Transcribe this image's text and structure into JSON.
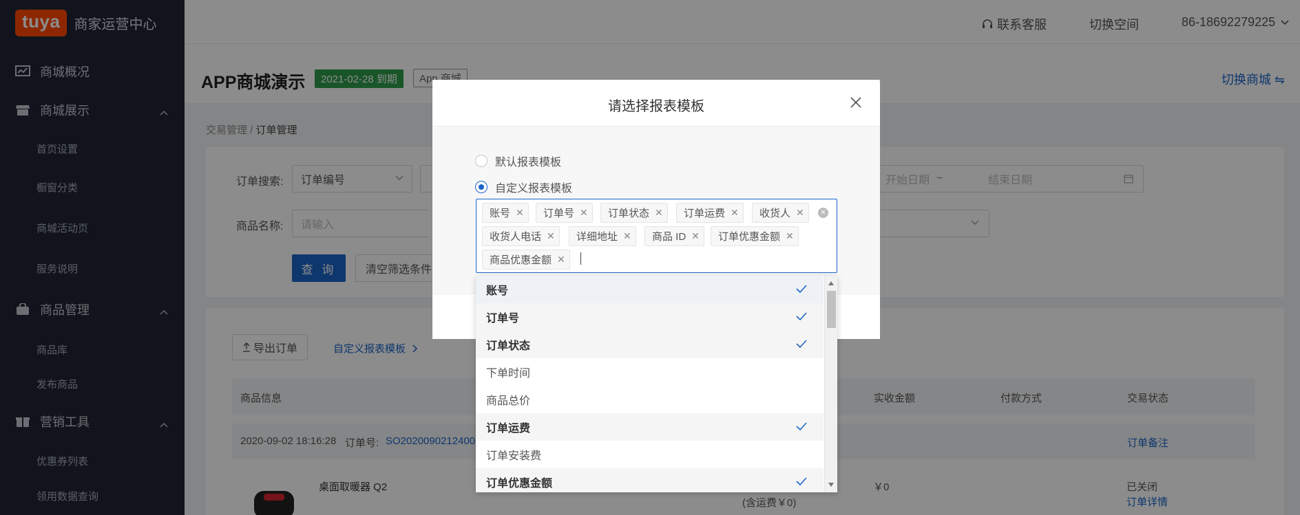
{
  "app": {
    "logo": "tuya",
    "title": "商家运营中心"
  },
  "sidebar": {
    "groups": [
      {
        "label": "商城概况",
        "icon": "chart-icon",
        "items": []
      },
      {
        "label": "商城展示",
        "icon": "store-icon",
        "items": [
          "首页设置",
          "橱窗分类",
          "商城活动页",
          "服务说明"
        ]
      },
      {
        "label": "商品管理",
        "icon": "bag-icon",
        "items": [
          "商品库",
          "发布商品"
        ]
      },
      {
        "label": "营销工具",
        "icon": "gift-icon",
        "items": [
          "优惠券列表",
          "领用数据查询"
        ]
      }
    ]
  },
  "topbar": {
    "support": "联系客服",
    "switch_space": "切换空间",
    "account": "86-18692279225"
  },
  "store": {
    "name": "APP商城演示",
    "expire": "2021-02-28 到期",
    "type": "App 商城",
    "switch": "切换商城 ⇋"
  },
  "breadcrumb": {
    "parent": "交易管理",
    "sep": " / ",
    "current": "订单管理"
  },
  "filters": {
    "order_search_label": "订单搜索:",
    "order_search_type": "订单编号",
    "product_name_label": "商品名称:",
    "product_name_placeholder": "请输入",
    "start_date": "开始日期",
    "date_sep": "~",
    "end_date": "结束日期",
    "query_btn": "查 询",
    "clear_btn": "清空筛选条件"
  },
  "orders": {
    "export_btn": "导出订单",
    "custom_template_link": "自定义报表模板",
    "columns": {
      "product_info": "商品信息",
      "received": "实收金额",
      "payment": "付款方式",
      "status": "交易状态"
    },
    "row": {
      "time": "2020-09-02 18:16:28",
      "order_no_label": "订单号:",
      "order_no": "SO2020090212400",
      "remark": "订单备注",
      "product_name": "桌面取暖器 Q2",
      "shipping": "(含运费￥0)",
      "amount": "￥0",
      "status": "已关闭",
      "detail": "订单详情"
    }
  },
  "modal": {
    "title": "请选择报表模板",
    "option_default": "默认报表模板",
    "option_custom": "自定义报表模板",
    "selected_tags": [
      "账号",
      "订单号",
      "订单状态",
      "订单运费",
      "收货人",
      "收货人电话",
      "详细地址",
      "商品 ID",
      "订单优惠金额",
      "商品优惠金额"
    ],
    "dropdown": [
      {
        "label": "账号",
        "selected": true
      },
      {
        "label": "订单号",
        "selected": true
      },
      {
        "label": "订单状态",
        "selected": true
      },
      {
        "label": "下单时间",
        "selected": false
      },
      {
        "label": "商品总价",
        "selected": false
      },
      {
        "label": "订单运费",
        "selected": true
      },
      {
        "label": "订单安装费",
        "selected": false
      },
      {
        "label": "订单优惠金额",
        "selected": true
      }
    ]
  },
  "colors": {
    "primary": "#1a64c8",
    "brand": "#ff4800",
    "sidebar_bg": "#1f2533",
    "badge_green": "#2e9b4a"
  }
}
